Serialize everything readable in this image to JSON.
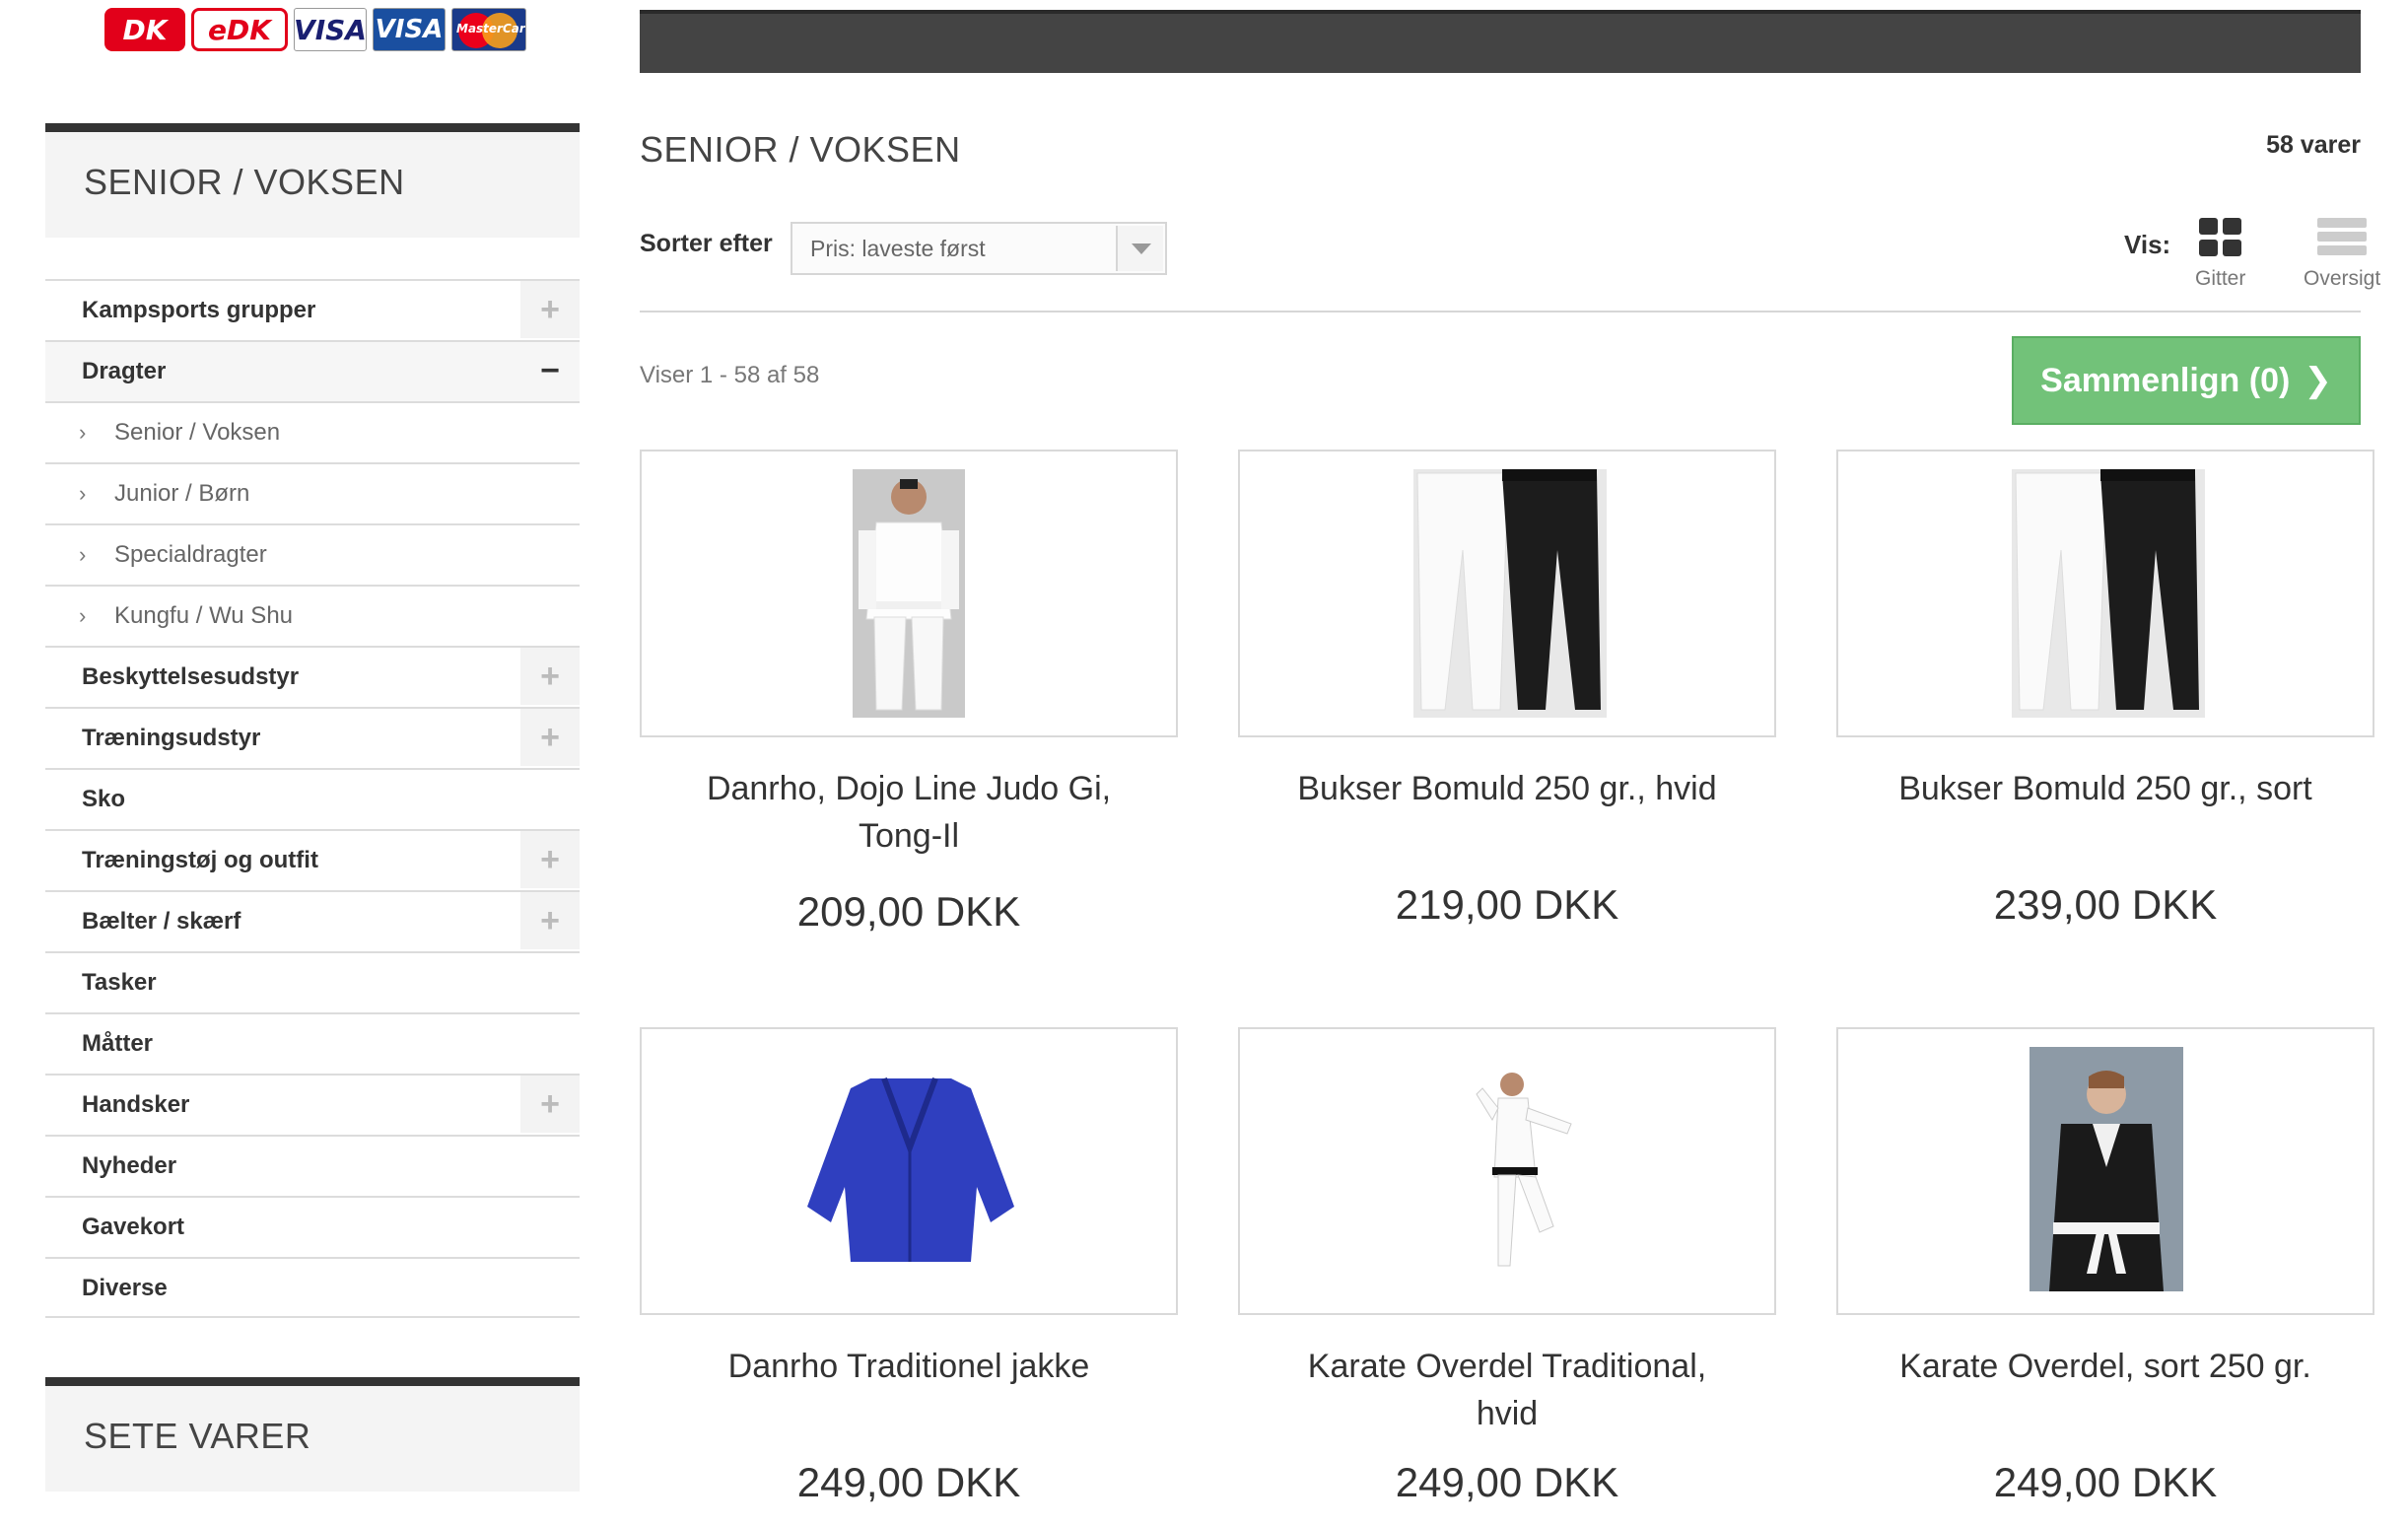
{
  "payment_logos": [
    {
      "icon": "dankort-logo",
      "text": "DK"
    },
    {
      "icon": "edankort-logo",
      "text": "eDK"
    },
    {
      "icon": "visa-logo",
      "text": "VISA"
    },
    {
      "icon": "visa-electron-logo",
      "text": "VISA"
    },
    {
      "icon": "mastercard-logo",
      "text": "MasterCard"
    }
  ],
  "sidebar": {
    "title": "SENIOR / VOKSEN",
    "categories": [
      {
        "label": "Kampsports grupper",
        "toggle": "+"
      },
      {
        "label": "Dragter",
        "toggle": "−"
      },
      {
        "label": "Senior / Voksen"
      },
      {
        "label": "Junior / Børn"
      },
      {
        "label": "Specialdragter"
      },
      {
        "label": "Kungfu / Wu Shu"
      },
      {
        "label": "Beskyttelsesudstyr",
        "toggle": "+"
      },
      {
        "label": "Træningsudstyr",
        "toggle": "+"
      },
      {
        "label": "Sko"
      },
      {
        "label": "Træningstøj og outfit",
        "toggle": "+"
      },
      {
        "label": "Bælter / skærf",
        "toggle": "+"
      },
      {
        "label": "Tasker"
      },
      {
        "label": "Måtter"
      },
      {
        "label": "Handsker",
        "toggle": "+"
      },
      {
        "label": "Nyheder"
      },
      {
        "label": "Gavekort"
      },
      {
        "label": "Diverse"
      }
    ],
    "viewed_title": "SETE VARER"
  },
  "main": {
    "heading": "SENIOR / VOKSEN",
    "count": "58 varer",
    "sort_label": "Sorter efter",
    "sort_value": "Pris: laveste først",
    "view_label": "Vis:",
    "view_grid": "Gitter",
    "view_list": "Oversigt",
    "showing": "Viser 1 - 58 af 58",
    "compare": "Sammenlign (0)"
  },
  "products": [
    {
      "name": "Danrho, Dojo Line Judo Gi, Tong-Il",
      "price": "209,00 DKK"
    },
    {
      "name": "Bukser Bomuld 250 gr., hvid",
      "price": "219,00 DKK"
    },
    {
      "name": "Bukser Bomuld 250 gr., sort",
      "price": "239,00 DKK"
    },
    {
      "name": "Danrho Traditionel jakke",
      "price": "249,00 DKK"
    },
    {
      "name": "Karate Overdel Traditional, hvid",
      "price": "249,00 DKK"
    },
    {
      "name": "Karate Overdel, sort 250 gr.",
      "price": "249,00 DKK"
    }
  ],
  "colors": {
    "compare_button": "#72c279",
    "topbar": "#444444"
  }
}
